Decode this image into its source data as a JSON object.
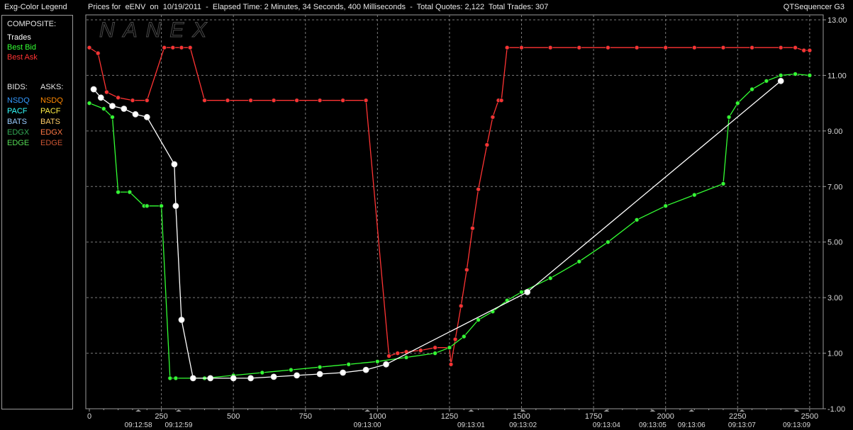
{
  "header": {
    "legend_title": "Exg-Color Legend",
    "chart_title": "Prices for  eENV  on  10/19/2011  -  Elapsed Time: 2 Minutes, 34 Seconds, 400 Milliseconds  -  Total Quotes: 2,122  Total Trades: 307",
    "app_name": "QTSequencer G3"
  },
  "legend": {
    "composite_label": "COMPOSITE:",
    "trades": {
      "label": "Trades",
      "color": "#ffffff"
    },
    "best_bid": {
      "label": "Best Bid",
      "color": "#33ff33"
    },
    "best_ask": {
      "label": "Best Ask",
      "color": "#ff3333"
    },
    "bids_header": "BIDS:",
    "asks_header": "ASKS:",
    "exchanges": [
      {
        "bid": "NSDQ",
        "ask": "NSDQ",
        "bid_color": "#3399ff",
        "ask_color": "#ff8800"
      },
      {
        "bid": "PACF",
        "ask": "PACF",
        "bid_color": "#33ffff",
        "ask_color": "#ffee44"
      },
      {
        "bid": "BATS",
        "ask": "BATS",
        "bid_color": "#99ccff",
        "ask_color": "#ffcc66"
      },
      {
        "bid": "EDGX",
        "ask": "EDGX",
        "bid_color": "#33aa55",
        "ask_color": "#ff7744"
      },
      {
        "bid": "EDGE",
        "ask": "EDGE",
        "bid_color": "#55dd55",
        "ask_color": "#cc5533"
      }
    ]
  },
  "watermark": "NANEX",
  "chart_data": {
    "type": "line",
    "title": "Prices for  eENV  on  10/19/2011",
    "xlim": [
      0,
      2520
    ],
    "ylim": [
      -1.0,
      13.0
    ],
    "grid": true,
    "x_ticks": [
      0,
      250,
      500,
      750,
      1000,
      1250,
      1500,
      1750,
      2000,
      2250,
      2500
    ],
    "y_ticks": [
      "13.00",
      "11.00",
      "9.00",
      "7.00",
      "5.00",
      "3.00",
      "1.00",
      "-1.00"
    ],
    "y_tick_values": [
      13,
      11,
      9,
      7,
      5,
      3,
      1,
      -1
    ],
    "time_labels": [
      {
        "x": 170,
        "label": "09:12:58"
      },
      {
        "x": 310,
        "label": "09:12:59"
      },
      {
        "x": 965,
        "label": "09:13:00"
      },
      {
        "x": 1325,
        "label": "09:13:01"
      },
      {
        "x": 1505,
        "label": "09:13:02"
      },
      {
        "x": 1795,
        "label": "09:13:04"
      },
      {
        "x": 1955,
        "label": "09:13:05"
      },
      {
        "x": 2090,
        "label": "09:13:06"
      },
      {
        "x": 2265,
        "label": "09:13:07"
      },
      {
        "x": 2455,
        "label": "09:13:09"
      }
    ],
    "series": [
      {
        "name": "Best Ask",
        "color": "#ff3333",
        "x": [
          0,
          30,
          60,
          100,
          150,
          200,
          260,
          290,
          320,
          350,
          400,
          480,
          560,
          640,
          720,
          800,
          880,
          960,
          1040,
          1070,
          1100,
          1150,
          1200,
          1250,
          1255,
          1270,
          1290,
          1310,
          1330,
          1350,
          1380,
          1400,
          1420,
          1430,
          1450,
          1500,
          1600,
          1700,
          1800,
          1900,
          2000,
          2100,
          2200,
          2300,
          2400,
          2450,
          2480,
          2500
        ],
        "y": [
          12.0,
          11.8,
          10.4,
          10.2,
          10.1,
          10.1,
          12.0,
          12.0,
          12.0,
          12.0,
          10.1,
          10.1,
          10.1,
          10.1,
          10.1,
          10.1,
          10.1,
          10.1,
          0.9,
          1.0,
          1.05,
          1.1,
          1.2,
          1.2,
          0.6,
          1.5,
          2.7,
          4.0,
          5.5,
          6.9,
          8.5,
          9.5,
          10.1,
          10.1,
          12.0,
          12.0,
          12.0,
          12.0,
          12.0,
          12.0,
          12.0,
          12.0,
          12.0,
          12.0,
          12.0,
          12.0,
          11.9,
          11.9
        ]
      },
      {
        "name": "Best Bid",
        "color": "#33ff33",
        "x": [
          0,
          50,
          80,
          100,
          140,
          190,
          200,
          250,
          280,
          300,
          400,
          500,
          600,
          700,
          800,
          900,
          1000,
          1100,
          1200,
          1250,
          1300,
          1350,
          1400,
          1450,
          1500,
          1600,
          1700,
          1800,
          1900,
          2000,
          2100,
          2200,
          2220,
          2250,
          2300,
          2350,
          2400,
          2450,
          2500
        ],
        "y": [
          10.0,
          9.8,
          9.5,
          6.8,
          6.8,
          6.3,
          6.3,
          6.3,
          0.1,
          0.1,
          0.1,
          0.2,
          0.3,
          0.4,
          0.5,
          0.6,
          0.7,
          0.85,
          1.0,
          1.2,
          1.6,
          2.2,
          2.5,
          2.9,
          3.2,
          3.7,
          4.3,
          5.0,
          5.8,
          6.3,
          6.7,
          7.1,
          9.5,
          10.0,
          10.5,
          10.8,
          11.0,
          11.05,
          11.0
        ]
      },
      {
        "name": "Trades",
        "color": "#ffffff",
        "x": [
          15,
          40,
          80,
          120,
          160,
          200,
          295,
          300,
          320,
          360,
          420,
          500,
          560,
          640,
          720,
          800,
          880,
          960,
          1030,
          1520,
          2400
        ],
        "y": [
          10.5,
          10.2,
          9.9,
          9.8,
          9.6,
          9.5,
          7.8,
          6.3,
          2.2,
          0.1,
          0.1,
          0.1,
          0.1,
          0.15,
          0.2,
          0.25,
          0.3,
          0.4,
          0.6,
          3.2,
          10.8
        ]
      }
    ]
  }
}
